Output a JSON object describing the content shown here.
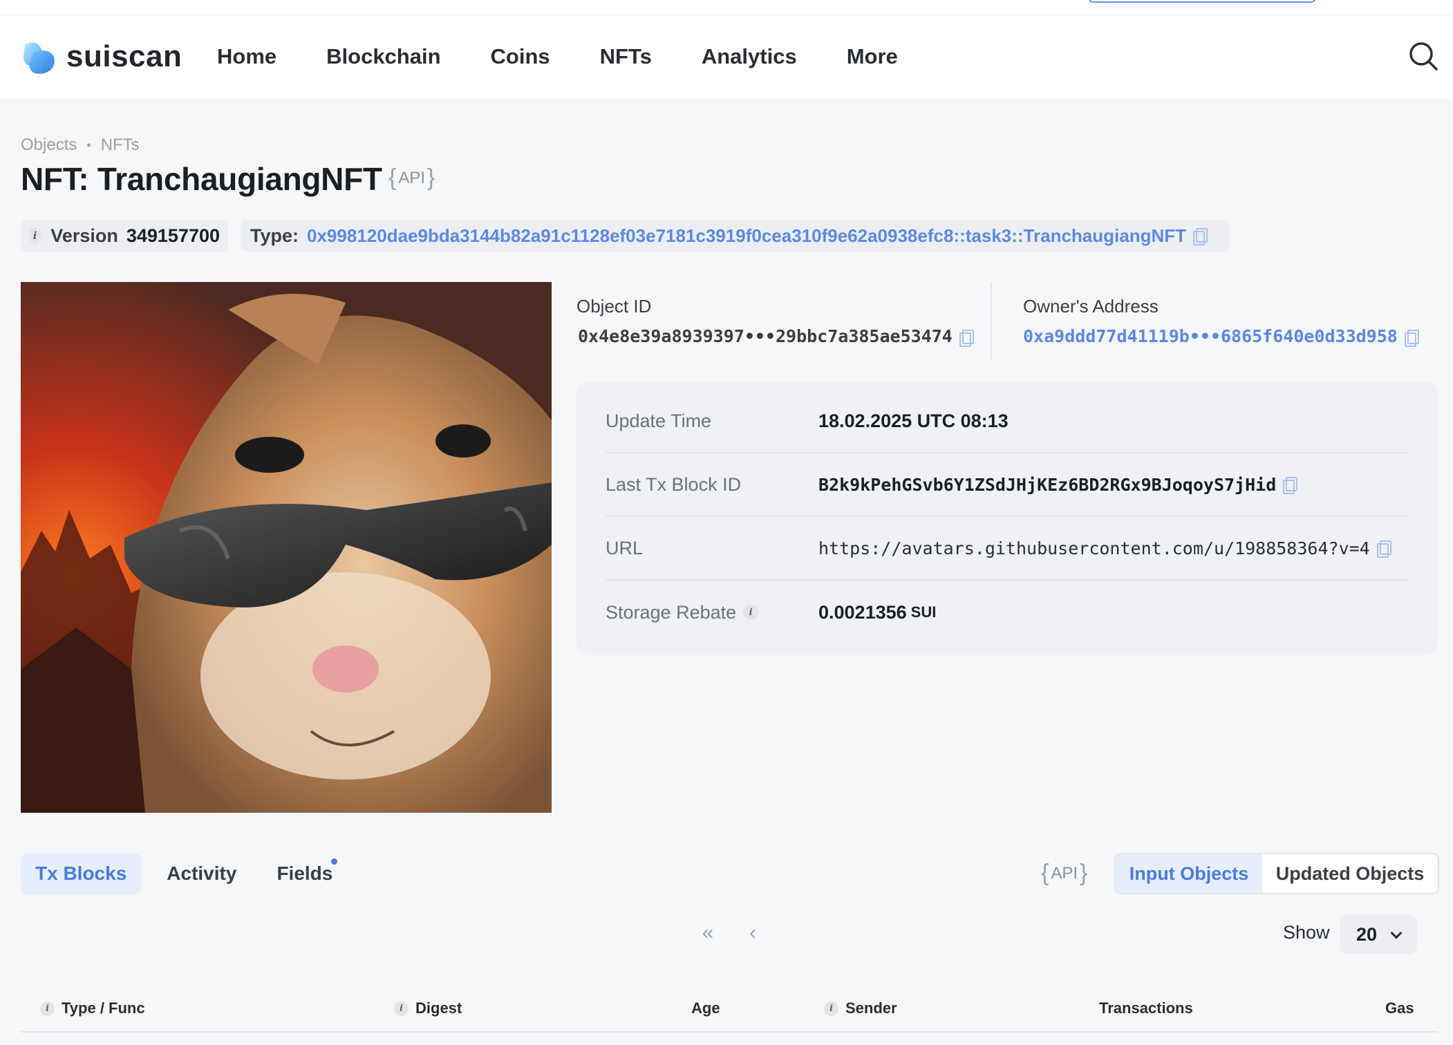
{
  "app": {
    "name": "suiscan"
  },
  "nav": {
    "items": [
      "Home",
      "Blockchain",
      "Coins",
      "NFTs",
      "Analytics",
      "More"
    ]
  },
  "breadcrumb": {
    "items": [
      "Objects",
      "NFTs"
    ]
  },
  "page": {
    "title": "NFT: TranchaugiangNFT",
    "api_label": "API"
  },
  "version": {
    "label": "Version",
    "value": "349157700"
  },
  "type": {
    "label": "Type:",
    "value": "0x998120dae9bda3144b82a91c1128ef03e7181c3919f0cea310f9e62a0938efc8::task3::TranchaugiangNFT"
  },
  "object": {
    "id_label": "Object ID",
    "id_value": "0x4e8e39a8939397•••29bbc7a385ae53474",
    "owner_label": "Owner's Address",
    "owner_value": "0xa9ddd77d41119b•••6865f640e0d33d958"
  },
  "details": {
    "update_time": {
      "label": "Update Time",
      "value": "18.02.2025 UTC 08:13"
    },
    "last_tx": {
      "label": "Last Tx Block ID",
      "value": "B2k9kPehGSvb6Y1ZSdJHjKEz6BD2RGx9BJoqoyS7jHid"
    },
    "url": {
      "label": "URL",
      "value": "https://avatars.githubusercontent.com/u/198858364?v=4"
    },
    "storage_rebate": {
      "label": "Storage Rebate",
      "value": "0.0021356",
      "unit": "SUI"
    }
  },
  "tabs": {
    "items": [
      "Tx Blocks",
      "Activity",
      "Fields"
    ],
    "active": "Tx Blocks"
  },
  "segment": {
    "items": [
      "Input Objects",
      "Updated Objects"
    ],
    "active": "Input Objects"
  },
  "pagination": {
    "first": "«",
    "prev": "‹",
    "show_label": "Show",
    "page_size": "20"
  },
  "table": {
    "columns": [
      "Type / Func",
      "Digest",
      "Age",
      "Sender",
      "Transactions",
      "Gas"
    ]
  },
  "colors": {
    "accent": "#4b7be0",
    "link": "#5b88e6",
    "background": "#f6f7f9"
  },
  "icons": {
    "search": "search-icon",
    "copy": "copy-icon",
    "info": "info-icon",
    "logo": "suiscan-logo-icon"
  }
}
